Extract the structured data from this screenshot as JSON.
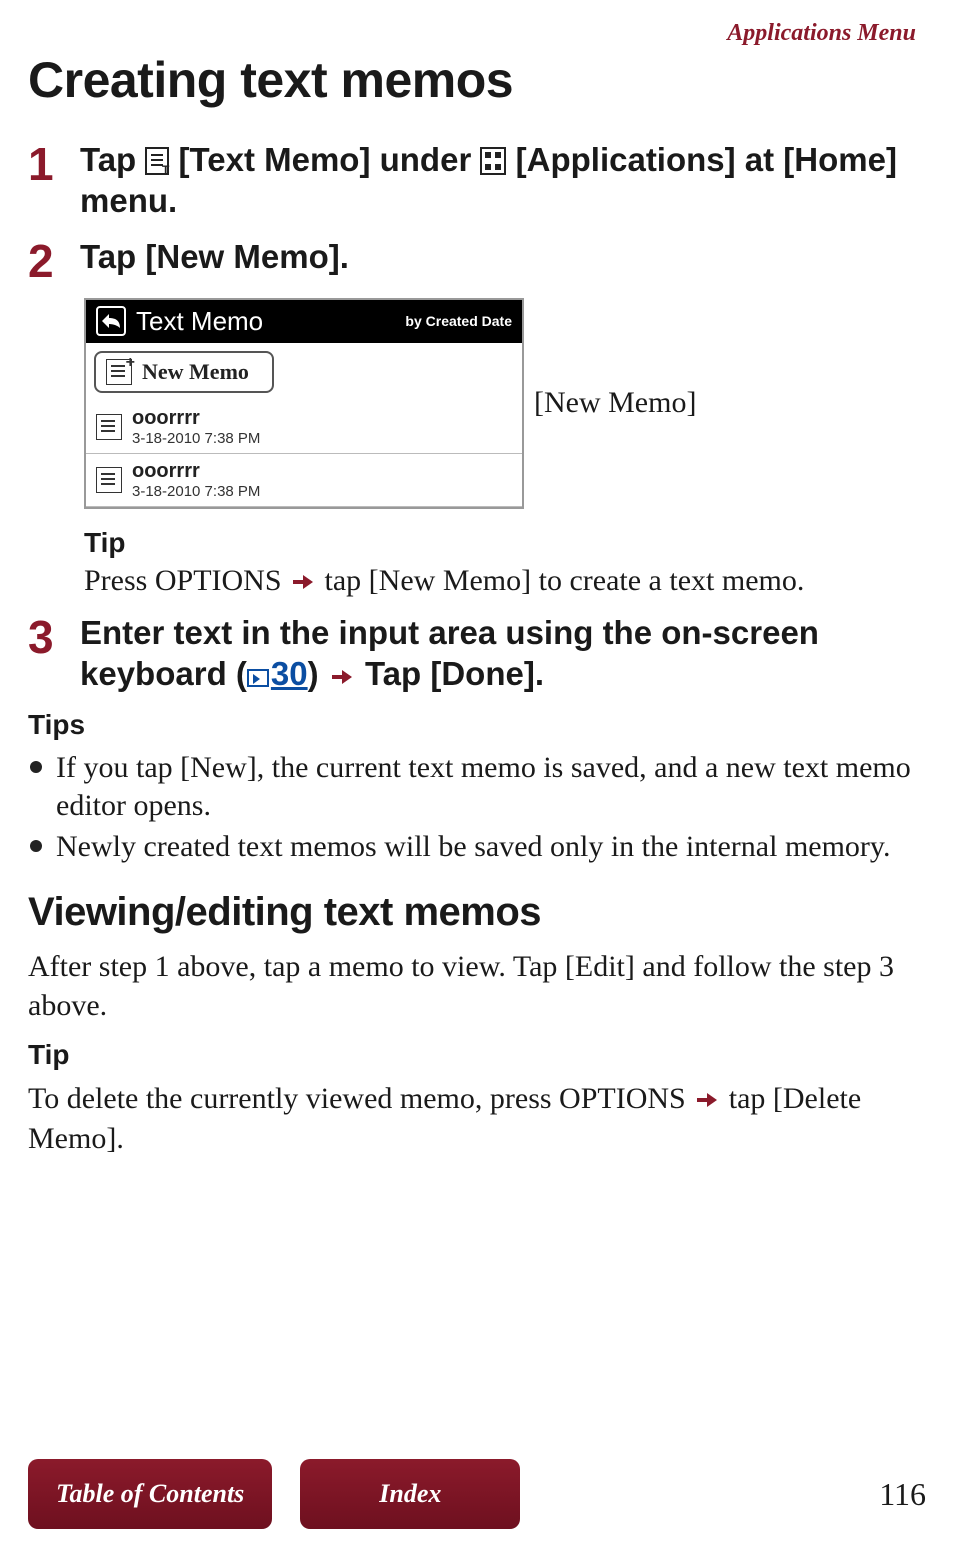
{
  "header_link": "Applications Menu",
  "title": "Creating text memos",
  "steps": [
    {
      "num": "1",
      "parts": [
        "Tap ",
        "ICON_MEMO",
        " [Text Memo] under ",
        "ICON_APPS",
        " [Applications] at [Home] menu."
      ]
    },
    {
      "num": "2",
      "parts": [
        "Tap [New Memo]."
      ]
    },
    {
      "num": "3",
      "parts": [
        "Enter text in the input area using the on-screen keyboard (",
        "PAGE_LINK",
        ") ",
        "ARROW",
        " Tap [Done]."
      ]
    }
  ],
  "page_link": "30",
  "screenshot": {
    "title": "Text Memo",
    "sort": "by Created Date",
    "new_label": "New Memo",
    "memos": [
      {
        "title": "ooorrrr",
        "date": "3-18-2010 7:38 PM"
      },
      {
        "title": "ooorrrr",
        "date": "3-18-2010 7:38 PM"
      }
    ],
    "callout": "[New Memo]"
  },
  "tip_after_step2_head": "Tip",
  "tip_after_step2_body_parts": [
    "Press OPTIONS ",
    "ARROW",
    " tap [New Memo] to create a text memo."
  ],
  "tips_head": "Tips",
  "tips": [
    "If you tap [New], the current text memo is saved, and a new text memo editor opens.",
    "Newly created text memos will be saved only in the internal memory."
  ],
  "sub_heading": "Viewing/editing text memos",
  "sub_body": "After step 1 above, tap a memo to view. Tap [Edit] and follow the step 3 above.",
  "tip2_head": "Tip",
  "tip2_body_parts": [
    "To delete the currently viewed memo, press OPTIONS ",
    "ARROW",
    " tap [Delete Memo]."
  ],
  "buttons": {
    "toc": "Table of Contents",
    "index": "Index"
  },
  "page_number": "116"
}
